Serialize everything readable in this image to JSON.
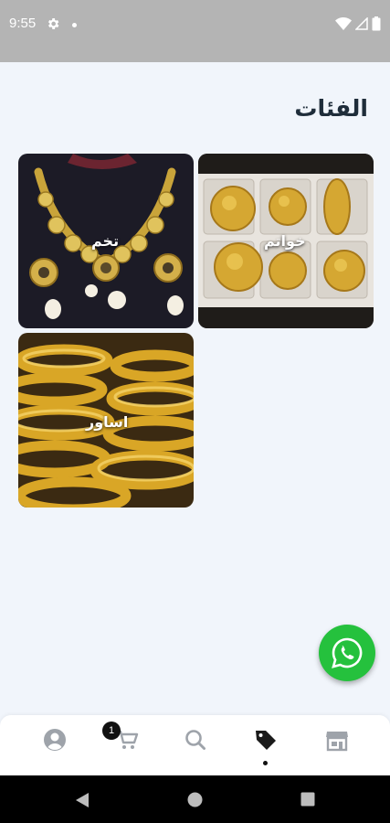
{
  "status_bar": {
    "time": "9:55"
  },
  "header": {
    "title": "الفئات"
  },
  "categories": [
    {
      "label": "خواتم"
    },
    {
      "label": "تخم"
    },
    {
      "label": "اساور"
    }
  ],
  "bottom_nav": {
    "items": [
      {
        "name": "profile",
        "icon": "person-icon"
      },
      {
        "name": "cart",
        "icon": "cart-icon",
        "badge": "1"
      },
      {
        "name": "search",
        "icon": "search-icon"
      },
      {
        "name": "categories",
        "icon": "tag-icon",
        "active": true
      },
      {
        "name": "store",
        "icon": "store-icon"
      }
    ]
  },
  "colors": {
    "background": "#f1f5fb",
    "status_bar": "#b4b4b4",
    "whatsapp": "#25c13d",
    "title": "#1f2d3a",
    "icon_gray": "#9ea3aa"
  }
}
